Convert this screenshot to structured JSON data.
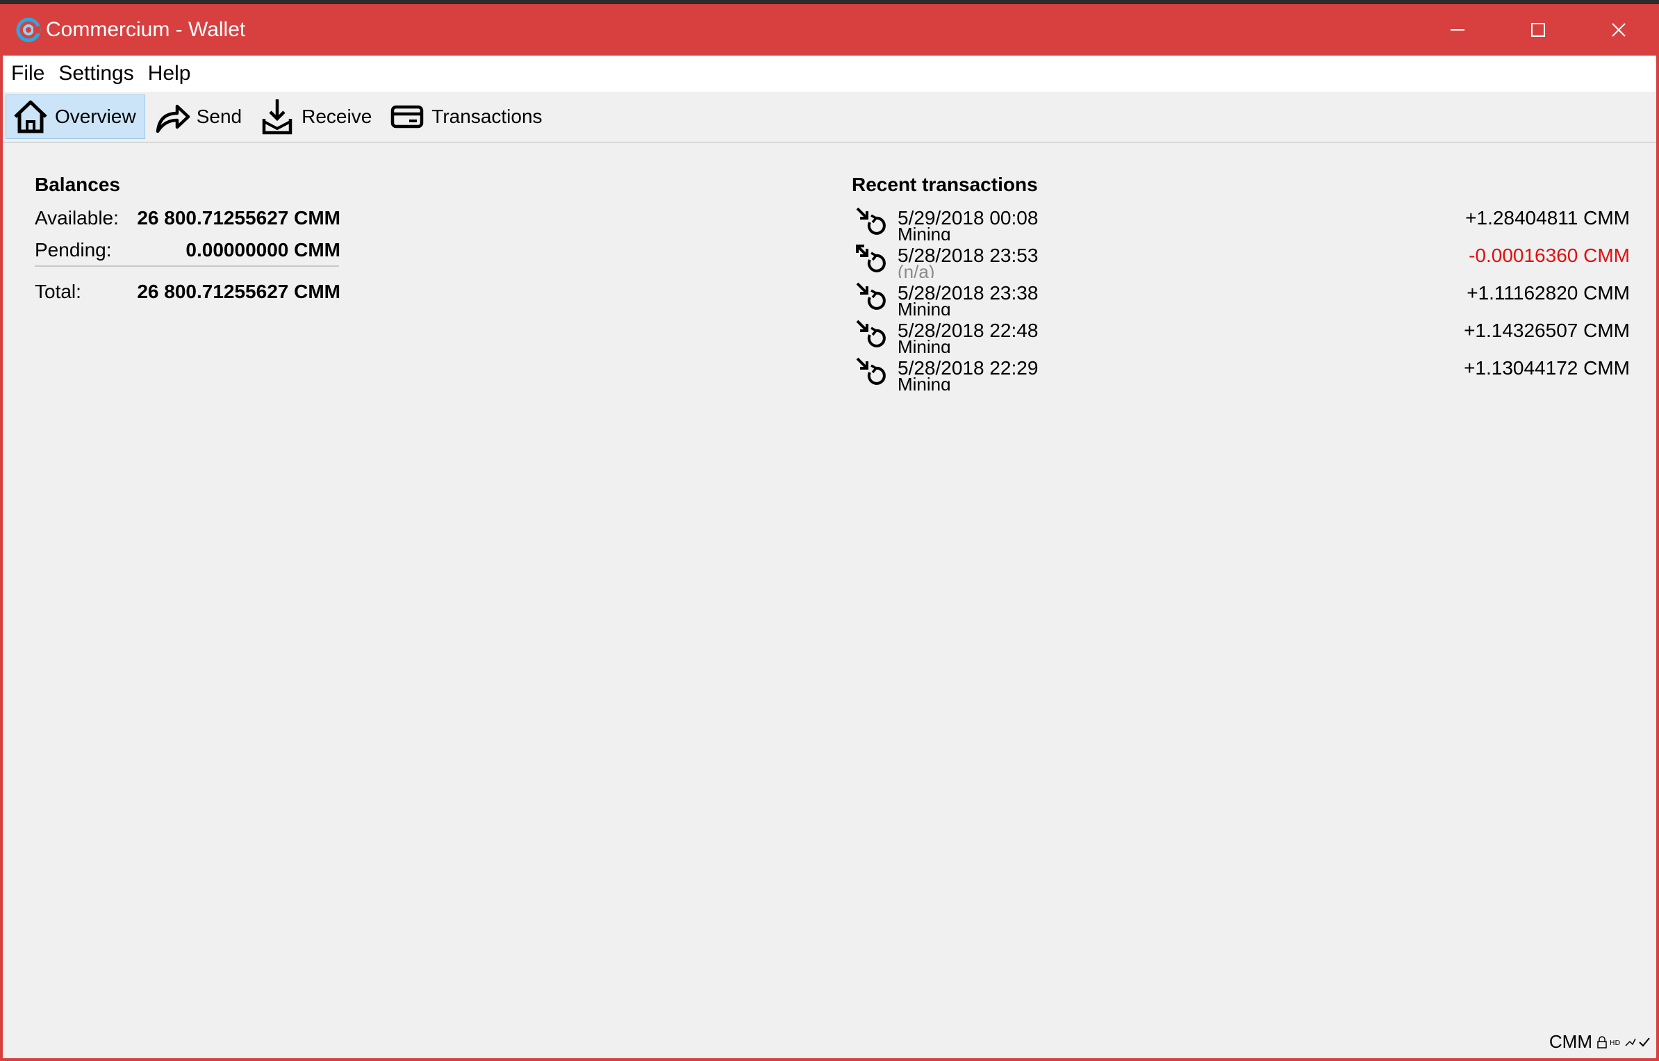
{
  "window": {
    "title": "Commercium - Wallet"
  },
  "menu": [
    "File",
    "Settings",
    "Help"
  ],
  "toolbar": {
    "overview": "Overview",
    "send": "Send",
    "receive": "Receive",
    "transactions": "Transactions"
  },
  "balances": {
    "heading": "Balances",
    "available_label": "Available:",
    "available_value": "26 800.71255627 CMM",
    "pending_label": "Pending:",
    "pending_value": "0.00000000 CMM",
    "total_label": "Total:",
    "total_value": "26 800.71255627 CMM"
  },
  "recent": {
    "heading": "Recent transactions",
    "items": [
      {
        "date": "5/29/2018 00:08",
        "label": "Mining",
        "amount": "+1.28404811 CMM",
        "icon": "mined-icon"
      },
      {
        "date": "5/28/2018 23:53",
        "label": "(n/a)",
        "amount": "-0.00016360 CMM",
        "icon": "payment-to-self-icon"
      },
      {
        "date": "5/28/2018 23:38",
        "label": "Mining",
        "amount": "+1.11162820 CMM",
        "icon": "mined-icon"
      },
      {
        "date": "5/28/2018 22:48",
        "label": "Mining",
        "amount": "+1.14326507 CMM",
        "icon": "mined-icon"
      },
      {
        "date": "5/28/2018 22:29",
        "label": "Mining",
        "amount": "+1.13044172 CMM",
        "icon": "mined-icon"
      }
    ]
  },
  "status": {
    "unit": "CMM"
  },
  "colors": {
    "titlebar": "#d84040",
    "negative": "#e01010",
    "active_tab": "#cce4f7"
  }
}
